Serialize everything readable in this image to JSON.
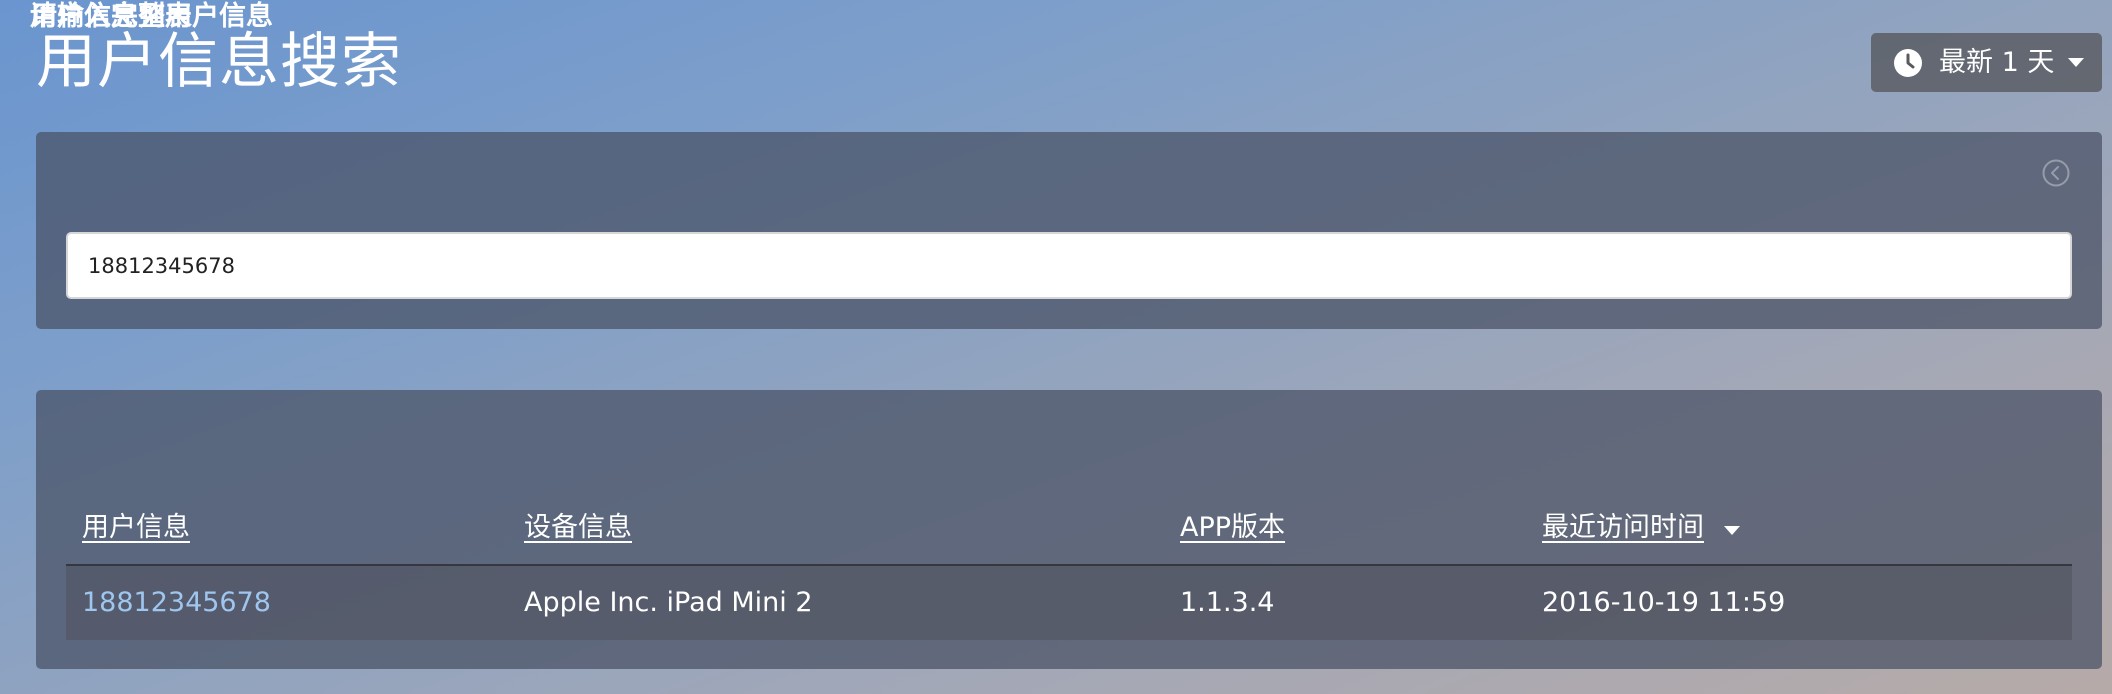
{
  "header": {
    "title": "用户信息搜索",
    "time_range_label": "最新 1 天"
  },
  "search": {
    "title": "请输入完整用户信息",
    "value": "18812345678"
  },
  "list": {
    "title": "用户信息列表",
    "columns": [
      "用户信息",
      "设备信息",
      "APP版本",
      "最近访问时间"
    ],
    "sorted_column": "最近访问时间",
    "rows": [
      {
        "user": "18812345678",
        "device": "Apple Inc. iPad Mini 2",
        "app_version": "1.1.3.4",
        "last_visit": "2016-10-19 11:59"
      }
    ]
  },
  "colors": {
    "link": "#9fc6ee",
    "panel": "rgba(72, 80, 100, 0.72)"
  },
  "icons": {
    "time": "clock-icon",
    "collapse": "chevron-left-circle-icon",
    "sort": "caret-down-icon"
  }
}
